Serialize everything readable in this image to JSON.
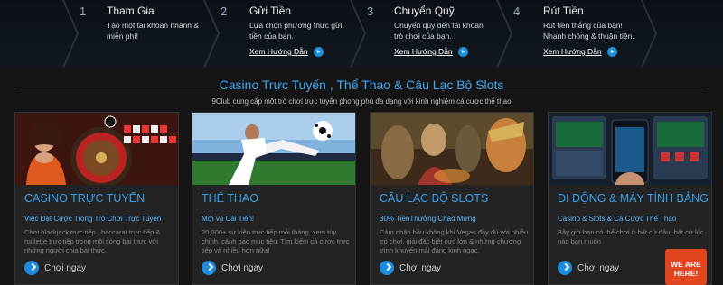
{
  "steps": [
    {
      "num": "1",
      "title": "Tham Gia",
      "desc": "Tạo một tài khoản nhanh & miễn phí!",
      "link": ""
    },
    {
      "num": "2",
      "title": "Gửi Tiền",
      "desc": "Lựa chọn phương thức gửi tiền của bạn.",
      "link": "Xem Hướng Dẫn"
    },
    {
      "num": "3",
      "title": "Chuyển Quỹ",
      "desc": "Chuyển quỹ đến tài khoản trò chơi của bạn.",
      "link": "Xem Hướng Dẫn"
    },
    {
      "num": "4",
      "title": "Rút Tiền",
      "desc": "Rút tiền thắng của bạn! Nhanh chóng & thuận tiện.",
      "link": "Xem Hướng Dẫn"
    }
  ],
  "heading": "Casino Trực Tuyến , Thể Thao & Câu Lạc Bộ Slots",
  "subheading": "9Club cung cấp một trò chơi trực tuyến phong phú đa dạng với kinh nghiệm cá cược thể thao",
  "cards": [
    {
      "title": "CASINO TRỰC TUYẾN",
      "sub": "Việc Đặt Cược Trong Trò Chơi Trực Tuyến",
      "desc": "Chơi blackjack trực tiếp , baccarat trực tiếp & roulette trực tiếp trong môi sòng bài thực với những người chia bài thực.",
      "btn": "Chơi ngay"
    },
    {
      "title": "THỂ THAO",
      "sub": "Mới và Cải Tiến!",
      "desc": "20,000+ sự kiện trực tiếp mỗi tháng, xem tùy chỉnh, cảnh báo mục tiêu, Tìm kiếm cá cược trực tiếp và nhiều hơn nữa!",
      "btn": "Chơi ngay"
    },
    {
      "title": "CÂU LẠC BỘ SLOTS",
      "sub": "30% TiềnThưởng Chào Mừng",
      "desc": "Cảm nhận bầu không khí Vegas đầy đủ với nhiều trò chơi, giải đặc biệt cực lớn & những chương trình khuyến mãi đáng kinh ngạc.",
      "btn": "Chơi ngay"
    },
    {
      "title": "DI ĐỘNG & MÁY TÍNH BẢNG",
      "sub": "Casino & Slots & Cá Cược Thể Thao",
      "desc": "Bây giờ bạn có thể chơi ở bất cứ đâu, bất cứ lúc nào bạn muốn",
      "btn": "Chơi ngay"
    }
  ],
  "badge": "WE ARE HERE!"
}
